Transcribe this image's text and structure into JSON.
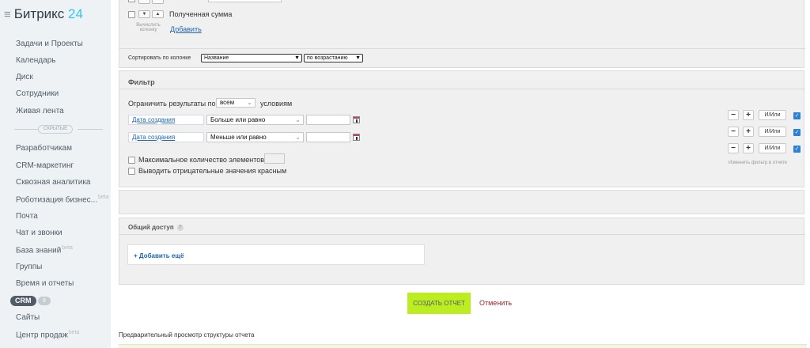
{
  "sidebar": {
    "logo_text": "Битрикс",
    "logo_num": "24",
    "hidden_label": "СКРЫТЫЕ",
    "beta": "beta",
    "crm_label": "CRM",
    "crm_count": "9",
    "items": [
      {
        "label": "Задачи и Проекты"
      },
      {
        "label": "Календарь"
      },
      {
        "label": "Диск"
      },
      {
        "label": "Сотрудники"
      },
      {
        "label": "Живая лента"
      },
      {
        "label": "Разработчикам"
      },
      {
        "label": "CRM-маркетинг"
      },
      {
        "label": "Сквозная аналитика"
      },
      {
        "label": "Роботизация бизнес..."
      },
      {
        "label": "Почта"
      },
      {
        "label": "Чат и звонки"
      },
      {
        "label": "База знаний"
      },
      {
        "label": "Группы"
      },
      {
        "label": "Время и отчеты"
      },
      {
        "label": "Сайты"
      },
      {
        "label": "Центр продаж"
      }
    ]
  },
  "columns": {
    "received_sum": "Полученная сумма",
    "calc_column": "Вычислить колонку",
    "add_link": "Добавить",
    "sort_label": "Сортировать по колонке",
    "sort_column": "Название",
    "sort_order": "по возрастанию"
  },
  "filter": {
    "title": "Фильтр",
    "limit_prefix": "Ограничить результаты по",
    "limit_value": "всем",
    "limit_suffix": "условиям",
    "rows": [
      {
        "field": "Дата создания",
        "operator": "Больше или равно",
        "andor": "И/Или"
      },
      {
        "field": "Дата создания",
        "operator": "Меньше или равно",
        "andor": "И/Или"
      }
    ],
    "extra_andor": "И/Или",
    "max_items": "Максимальное количество элементов",
    "negative_red": "Выводить отрицательные значения красным",
    "change_filter": "Изменить фильтр в отчете",
    "minus": "−",
    "plus": "+"
  },
  "access": {
    "title": "Общий доступ",
    "add_more": "Добавить ещё"
  },
  "actions": {
    "create": "СОЗДАТЬ ОТЧЕТ",
    "cancel": "Отменить"
  },
  "preview": {
    "title": "Предварительный просмотр структуры отчета"
  }
}
